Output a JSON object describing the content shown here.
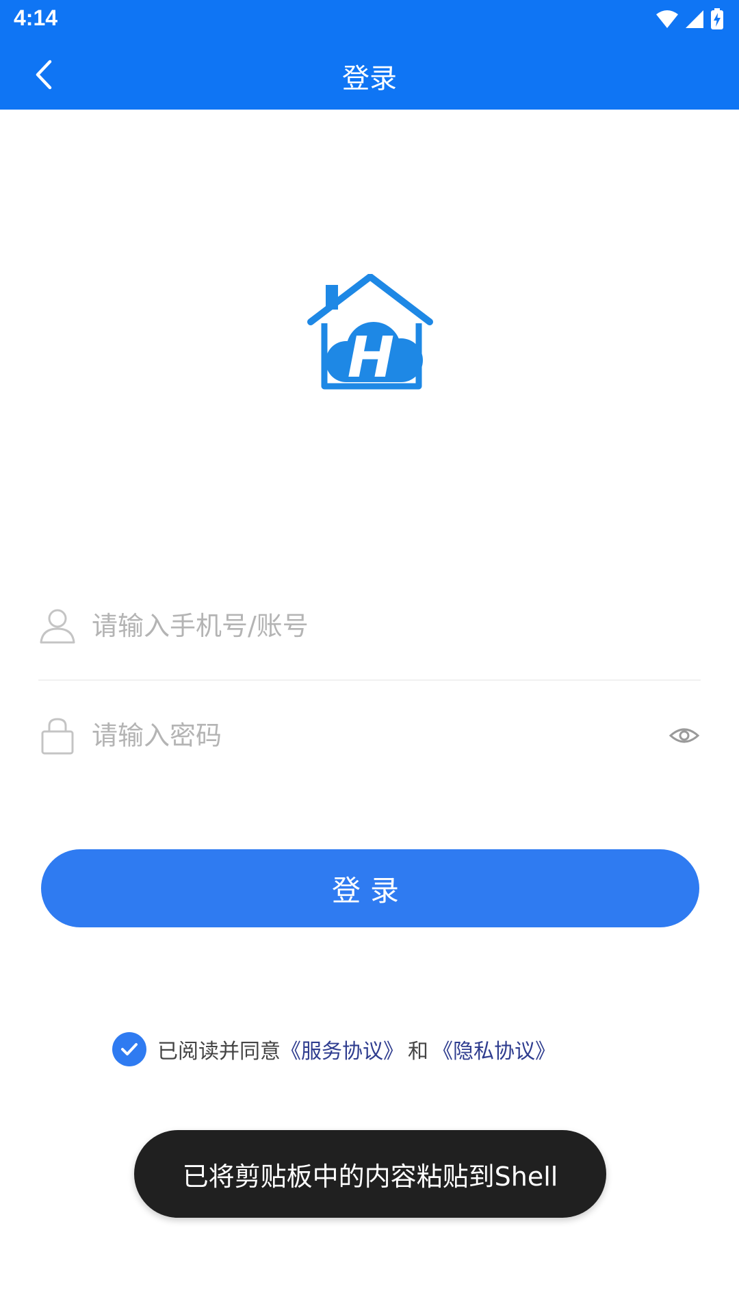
{
  "status_bar": {
    "time": "4:14",
    "icons": [
      "wifi-icon",
      "cellular-signal-icon",
      "battery-charging-icon"
    ]
  },
  "app_bar": {
    "title": "登录",
    "back_icon": "chevron-left-icon"
  },
  "logo": {
    "letter": "H",
    "icon": "house-logo-icon"
  },
  "username": {
    "placeholder": "请输入手机号/账号",
    "value": "",
    "icon": "person-icon"
  },
  "password": {
    "placeholder": "请输入密码",
    "value": "",
    "icon": "lock-icon",
    "toggle_icon": "eye-icon"
  },
  "login_button": {
    "label": "登录"
  },
  "agreement": {
    "checked": true,
    "prefix": "已阅读并同意",
    "service_link": "《服务协议》",
    "conjunction": "和",
    "privacy_link": "《隐私协议》"
  },
  "toast": {
    "message": "已将剪贴板中的内容粘贴到Shell"
  },
  "colors": {
    "header": "#0F75F4",
    "primary_button": "#2F7BF1",
    "placeholder": "#B4B4B4",
    "link": "#2F3D8F",
    "toast_bg": "#202020"
  }
}
